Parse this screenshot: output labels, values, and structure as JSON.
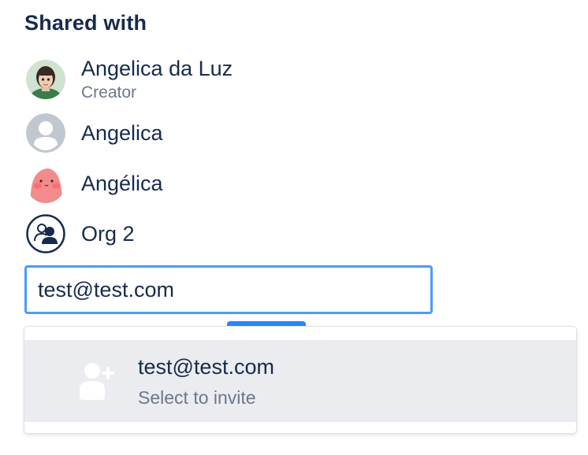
{
  "shared_with": {
    "title": "Shared with",
    "people": [
      {
        "name": "Angelica da Luz",
        "role": "Creator",
        "avatar": "photo-avatar"
      },
      {
        "name": "Angelica",
        "role": "",
        "avatar": "default-user-avatar"
      },
      {
        "name": "Angélica",
        "role": "",
        "avatar": "pink-character-avatar"
      },
      {
        "name": "Org 2",
        "role": "",
        "avatar": "organization-icon"
      }
    ]
  },
  "invite": {
    "input_value": "test@test.com"
  },
  "suggestion": {
    "email": "test@test.com",
    "hint": "Select to invite",
    "icon": "add-user-icon"
  },
  "colors": {
    "text": "#172b4d",
    "subtle_text": "#6b778c",
    "focus_border": "#4c9aff",
    "option_bg": "#ebecf0"
  }
}
